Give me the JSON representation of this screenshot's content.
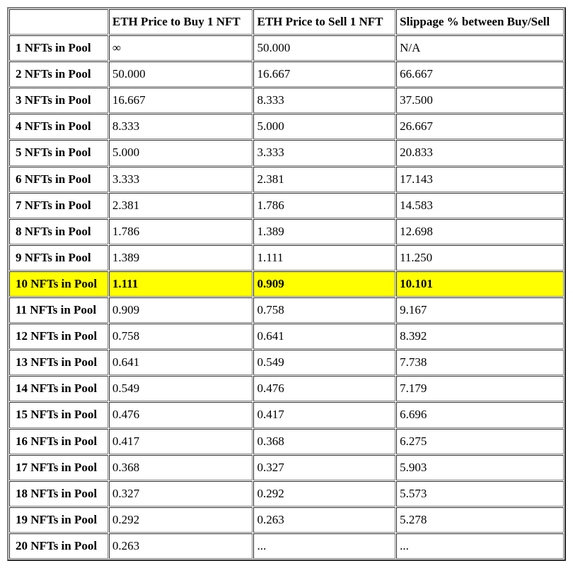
{
  "table": {
    "headers": {
      "corner": "",
      "col1": "ETH Price to Buy 1 NFT",
      "col2": "ETH Price to Sell 1 NFT",
      "col3": "Slippage % between Buy/Sell"
    },
    "rows": [
      {
        "label": "1 NFTs in Pool",
        "buy": "∞",
        "sell": "50.000",
        "slippage": "N/A",
        "highlight": false
      },
      {
        "label": "2 NFTs in Pool",
        "buy": "50.000",
        "sell": "16.667",
        "slippage": "66.667",
        "highlight": false
      },
      {
        "label": "3 NFTs in Pool",
        "buy": "16.667",
        "sell": "8.333",
        "slippage": "37.500",
        "highlight": false
      },
      {
        "label": "4 NFTs in Pool",
        "buy": "8.333",
        "sell": "5.000",
        "slippage": "26.667",
        "highlight": false
      },
      {
        "label": "5 NFTs in Pool",
        "buy": "5.000",
        "sell": "3.333",
        "slippage": "20.833",
        "highlight": false
      },
      {
        "label": "6 NFTs in Pool",
        "buy": "3.333",
        "sell": "2.381",
        "slippage": "17.143",
        "highlight": false
      },
      {
        "label": "7 NFTs in Pool",
        "buy": "2.381",
        "sell": "1.786",
        "slippage": "14.583",
        "highlight": false
      },
      {
        "label": "8 NFTs in Pool",
        "buy": "1.786",
        "sell": "1.389",
        "slippage": "12.698",
        "highlight": false
      },
      {
        "label": "9 NFTs in Pool",
        "buy": "1.389",
        "sell": "1.111",
        "slippage": "11.250",
        "highlight": false
      },
      {
        "label": "10 NFTs in Pool",
        "buy": "1.111",
        "sell": "0.909",
        "slippage": "10.101",
        "highlight": true
      },
      {
        "label": "11 NFTs in Pool",
        "buy": "0.909",
        "sell": "0.758",
        "slippage": "9.167",
        "highlight": false
      },
      {
        "label": "12 NFTs in Pool",
        "buy": "0.758",
        "sell": "0.641",
        "slippage": "8.392",
        "highlight": false
      },
      {
        "label": "13 NFTs in Pool",
        "buy": "0.641",
        "sell": "0.549",
        "slippage": "7.738",
        "highlight": false
      },
      {
        "label": "14 NFTs in Pool",
        "buy": "0.549",
        "sell": "0.476",
        "slippage": "7.179",
        "highlight": false
      },
      {
        "label": "15 NFTs in Pool",
        "buy": "0.476",
        "sell": "0.417",
        "slippage": "6.696",
        "highlight": false
      },
      {
        "label": "16 NFTs in Pool",
        "buy": "0.417",
        "sell": "0.368",
        "slippage": "6.275",
        "highlight": false
      },
      {
        "label": "17 NFTs in Pool",
        "buy": "0.368",
        "sell": "0.327",
        "slippage": "5.903",
        "highlight": false
      },
      {
        "label": "18 NFTs in Pool",
        "buy": "0.327",
        "sell": "0.292",
        "slippage": "5.573",
        "highlight": false
      },
      {
        "label": "19 NFTs in Pool",
        "buy": "0.292",
        "sell": "0.263",
        "slippage": "5.278",
        "highlight": false
      },
      {
        "label": "20 NFTs in Pool",
        "buy": "0.263",
        "sell": "...",
        "slippage": "...",
        "highlight": false
      }
    ]
  }
}
